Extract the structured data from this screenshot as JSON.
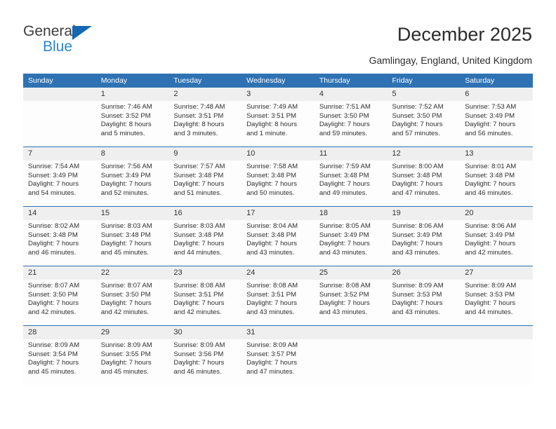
{
  "brand": {
    "name_top": "General",
    "name_bottom": "Blue",
    "color_dark": "#3d3d3d",
    "color_blue": "#2a86d6",
    "triangle_color": "#1567b2"
  },
  "header": {
    "title": "December 2025",
    "location": "Gamlingay, England, United Kingdom"
  },
  "theme": {
    "header_bg": "#2e72b3",
    "header_text": "#ffffff",
    "date_band_bg": "#efefef",
    "cell_bg": "#fdfdfd",
    "week_divider": "#2e72b3"
  },
  "weekday_headers": [
    "Sunday",
    "Monday",
    "Tuesday",
    "Wednesday",
    "Thursday",
    "Friday",
    "Saturday"
  ],
  "weeks": [
    [
      {
        "date": "",
        "lines": []
      },
      {
        "date": "1",
        "lines": [
          "Sunrise: 7:46 AM",
          "Sunset: 3:52 PM",
          "Daylight: 8 hours",
          "and 5 minutes."
        ]
      },
      {
        "date": "2",
        "lines": [
          "Sunrise: 7:48 AM",
          "Sunset: 3:51 PM",
          "Daylight: 8 hours",
          "and 3 minutes."
        ]
      },
      {
        "date": "3",
        "lines": [
          "Sunrise: 7:49 AM",
          "Sunset: 3:51 PM",
          "Daylight: 8 hours",
          "and 1 minute."
        ]
      },
      {
        "date": "4",
        "lines": [
          "Sunrise: 7:51 AM",
          "Sunset: 3:50 PM",
          "Daylight: 7 hours",
          "and 59 minutes."
        ]
      },
      {
        "date": "5",
        "lines": [
          "Sunrise: 7:52 AM",
          "Sunset: 3:50 PM",
          "Daylight: 7 hours",
          "and 57 minutes."
        ]
      },
      {
        "date": "6",
        "lines": [
          "Sunrise: 7:53 AM",
          "Sunset: 3:49 PM",
          "Daylight: 7 hours",
          "and 56 minutes."
        ]
      }
    ],
    [
      {
        "date": "7",
        "lines": [
          "Sunrise: 7:54 AM",
          "Sunset: 3:49 PM",
          "Daylight: 7 hours",
          "and 54 minutes."
        ]
      },
      {
        "date": "8",
        "lines": [
          "Sunrise: 7:56 AM",
          "Sunset: 3:49 PM",
          "Daylight: 7 hours",
          "and 52 minutes."
        ]
      },
      {
        "date": "9",
        "lines": [
          "Sunrise: 7:57 AM",
          "Sunset: 3:48 PM",
          "Daylight: 7 hours",
          "and 51 minutes."
        ]
      },
      {
        "date": "10",
        "lines": [
          "Sunrise: 7:58 AM",
          "Sunset: 3:48 PM",
          "Daylight: 7 hours",
          "and 50 minutes."
        ]
      },
      {
        "date": "11",
        "lines": [
          "Sunrise: 7:59 AM",
          "Sunset: 3:48 PM",
          "Daylight: 7 hours",
          "and 49 minutes."
        ]
      },
      {
        "date": "12",
        "lines": [
          "Sunrise: 8:00 AM",
          "Sunset: 3:48 PM",
          "Daylight: 7 hours",
          "and 47 minutes."
        ]
      },
      {
        "date": "13",
        "lines": [
          "Sunrise: 8:01 AM",
          "Sunset: 3:48 PM",
          "Daylight: 7 hours",
          "and 46 minutes."
        ]
      }
    ],
    [
      {
        "date": "14",
        "lines": [
          "Sunrise: 8:02 AM",
          "Sunset: 3:48 PM",
          "Daylight: 7 hours",
          "and 46 minutes."
        ]
      },
      {
        "date": "15",
        "lines": [
          "Sunrise: 8:03 AM",
          "Sunset: 3:48 PM",
          "Daylight: 7 hours",
          "and 45 minutes."
        ]
      },
      {
        "date": "16",
        "lines": [
          "Sunrise: 8:03 AM",
          "Sunset: 3:48 PM",
          "Daylight: 7 hours",
          "and 44 minutes."
        ]
      },
      {
        "date": "17",
        "lines": [
          "Sunrise: 8:04 AM",
          "Sunset: 3:48 PM",
          "Daylight: 7 hours",
          "and 43 minutes."
        ]
      },
      {
        "date": "18",
        "lines": [
          "Sunrise: 8:05 AM",
          "Sunset: 3:49 PM",
          "Daylight: 7 hours",
          "and 43 minutes."
        ]
      },
      {
        "date": "19",
        "lines": [
          "Sunrise: 8:06 AM",
          "Sunset: 3:49 PM",
          "Daylight: 7 hours",
          "and 43 minutes."
        ]
      },
      {
        "date": "20",
        "lines": [
          "Sunrise: 8:06 AM",
          "Sunset: 3:49 PM",
          "Daylight: 7 hours",
          "and 42 minutes."
        ]
      }
    ],
    [
      {
        "date": "21",
        "lines": [
          "Sunrise: 8:07 AM",
          "Sunset: 3:50 PM",
          "Daylight: 7 hours",
          "and 42 minutes."
        ]
      },
      {
        "date": "22",
        "lines": [
          "Sunrise: 8:07 AM",
          "Sunset: 3:50 PM",
          "Daylight: 7 hours",
          "and 42 minutes."
        ]
      },
      {
        "date": "23",
        "lines": [
          "Sunrise: 8:08 AM",
          "Sunset: 3:51 PM",
          "Daylight: 7 hours",
          "and 42 minutes."
        ]
      },
      {
        "date": "24",
        "lines": [
          "Sunrise: 8:08 AM",
          "Sunset: 3:51 PM",
          "Daylight: 7 hours",
          "and 43 minutes."
        ]
      },
      {
        "date": "25",
        "lines": [
          "Sunrise: 8:08 AM",
          "Sunset: 3:52 PM",
          "Daylight: 7 hours",
          "and 43 minutes."
        ]
      },
      {
        "date": "26",
        "lines": [
          "Sunrise: 8:09 AM",
          "Sunset: 3:53 PM",
          "Daylight: 7 hours",
          "and 43 minutes."
        ]
      },
      {
        "date": "27",
        "lines": [
          "Sunrise: 8:09 AM",
          "Sunset: 3:53 PM",
          "Daylight: 7 hours",
          "and 44 minutes."
        ]
      }
    ],
    [
      {
        "date": "28",
        "lines": [
          "Sunrise: 8:09 AM",
          "Sunset: 3:54 PM",
          "Daylight: 7 hours",
          "and 45 minutes."
        ]
      },
      {
        "date": "29",
        "lines": [
          "Sunrise: 8:09 AM",
          "Sunset: 3:55 PM",
          "Daylight: 7 hours",
          "and 45 minutes."
        ]
      },
      {
        "date": "30",
        "lines": [
          "Sunrise: 8:09 AM",
          "Sunset: 3:56 PM",
          "Daylight: 7 hours",
          "and 46 minutes."
        ]
      },
      {
        "date": "31",
        "lines": [
          "Sunrise: 8:09 AM",
          "Sunset: 3:57 PM",
          "Daylight: 7 hours",
          "and 47 minutes."
        ]
      },
      {
        "date": "",
        "lines": []
      },
      {
        "date": "",
        "lines": []
      },
      {
        "date": "",
        "lines": []
      }
    ]
  ]
}
